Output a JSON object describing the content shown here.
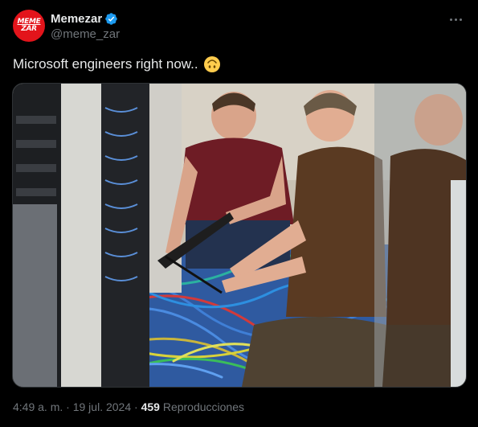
{
  "author": {
    "display_name": "Memezar",
    "handle": "@meme_zar",
    "avatar_line1": "MEME",
    "avatar_line2": "ZAR",
    "verified_color": "#1d9bf0",
    "brand_color": "#e3141b"
  },
  "tweet": {
    "text": "Microsoft engineers right now..",
    "emoji": "upside-down-face-emoji"
  },
  "meta": {
    "time": "4:49 a. m.",
    "sep1": "·",
    "date": "19 jul. 2024",
    "sep2": "·",
    "views_count": "459",
    "views_label": "Reproducciones"
  },
  "icons": {
    "more": "more-icon",
    "verified": "verified-badge-icon"
  }
}
